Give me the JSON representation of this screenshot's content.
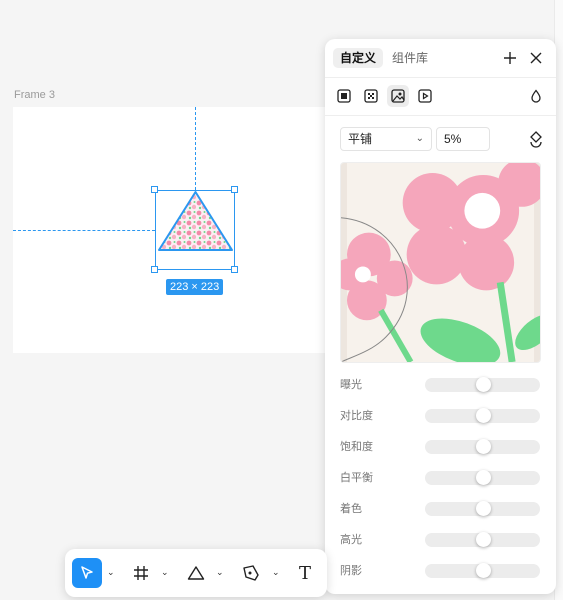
{
  "canvas": {
    "frame_label": "Frame 3",
    "size_badge": "223 × 223"
  },
  "panel": {
    "tabs": [
      {
        "label": "自定义",
        "active": true
      },
      {
        "label": "组件库",
        "active": false
      }
    ],
    "header_icons": [
      "plus-icon",
      "close-icon"
    ],
    "fill_modes": [
      "solid-fill-icon",
      "gradient-fill-icon",
      "image-fill-icon",
      "video-fill-icon"
    ],
    "selected_fill_mode": "image-fill-icon",
    "opacity_icon": "droplet-icon",
    "image_fit": "平铺",
    "scale": "5%",
    "rotate_icon": "rotate-icon",
    "adjustments": [
      {
        "label": "曝光",
        "value": 0.5
      },
      {
        "label": "对比度",
        "value": 0.5
      },
      {
        "label": "饱和度",
        "value": 0.5
      },
      {
        "label": "白平衡",
        "value": 0.5
      },
      {
        "label": "着色",
        "value": 0.5
      },
      {
        "label": "高光",
        "value": 0.5
      },
      {
        "label": "阴影",
        "value": 0.5
      }
    ]
  },
  "toolbar": {
    "tools": [
      "move-tool-icon",
      "frame-tool-icon",
      "shape-tool-icon",
      "pen-tool-icon",
      "text-tool-icon"
    ],
    "selected_tool": "move-tool-icon"
  },
  "colors": {
    "accent": "#2b97f0",
    "selected_tool_bg": "#1e90f6",
    "flower_pink": "#f5a6bb",
    "leaf_green": "#6ed98c",
    "preview_bg": "#f7f2ec"
  }
}
